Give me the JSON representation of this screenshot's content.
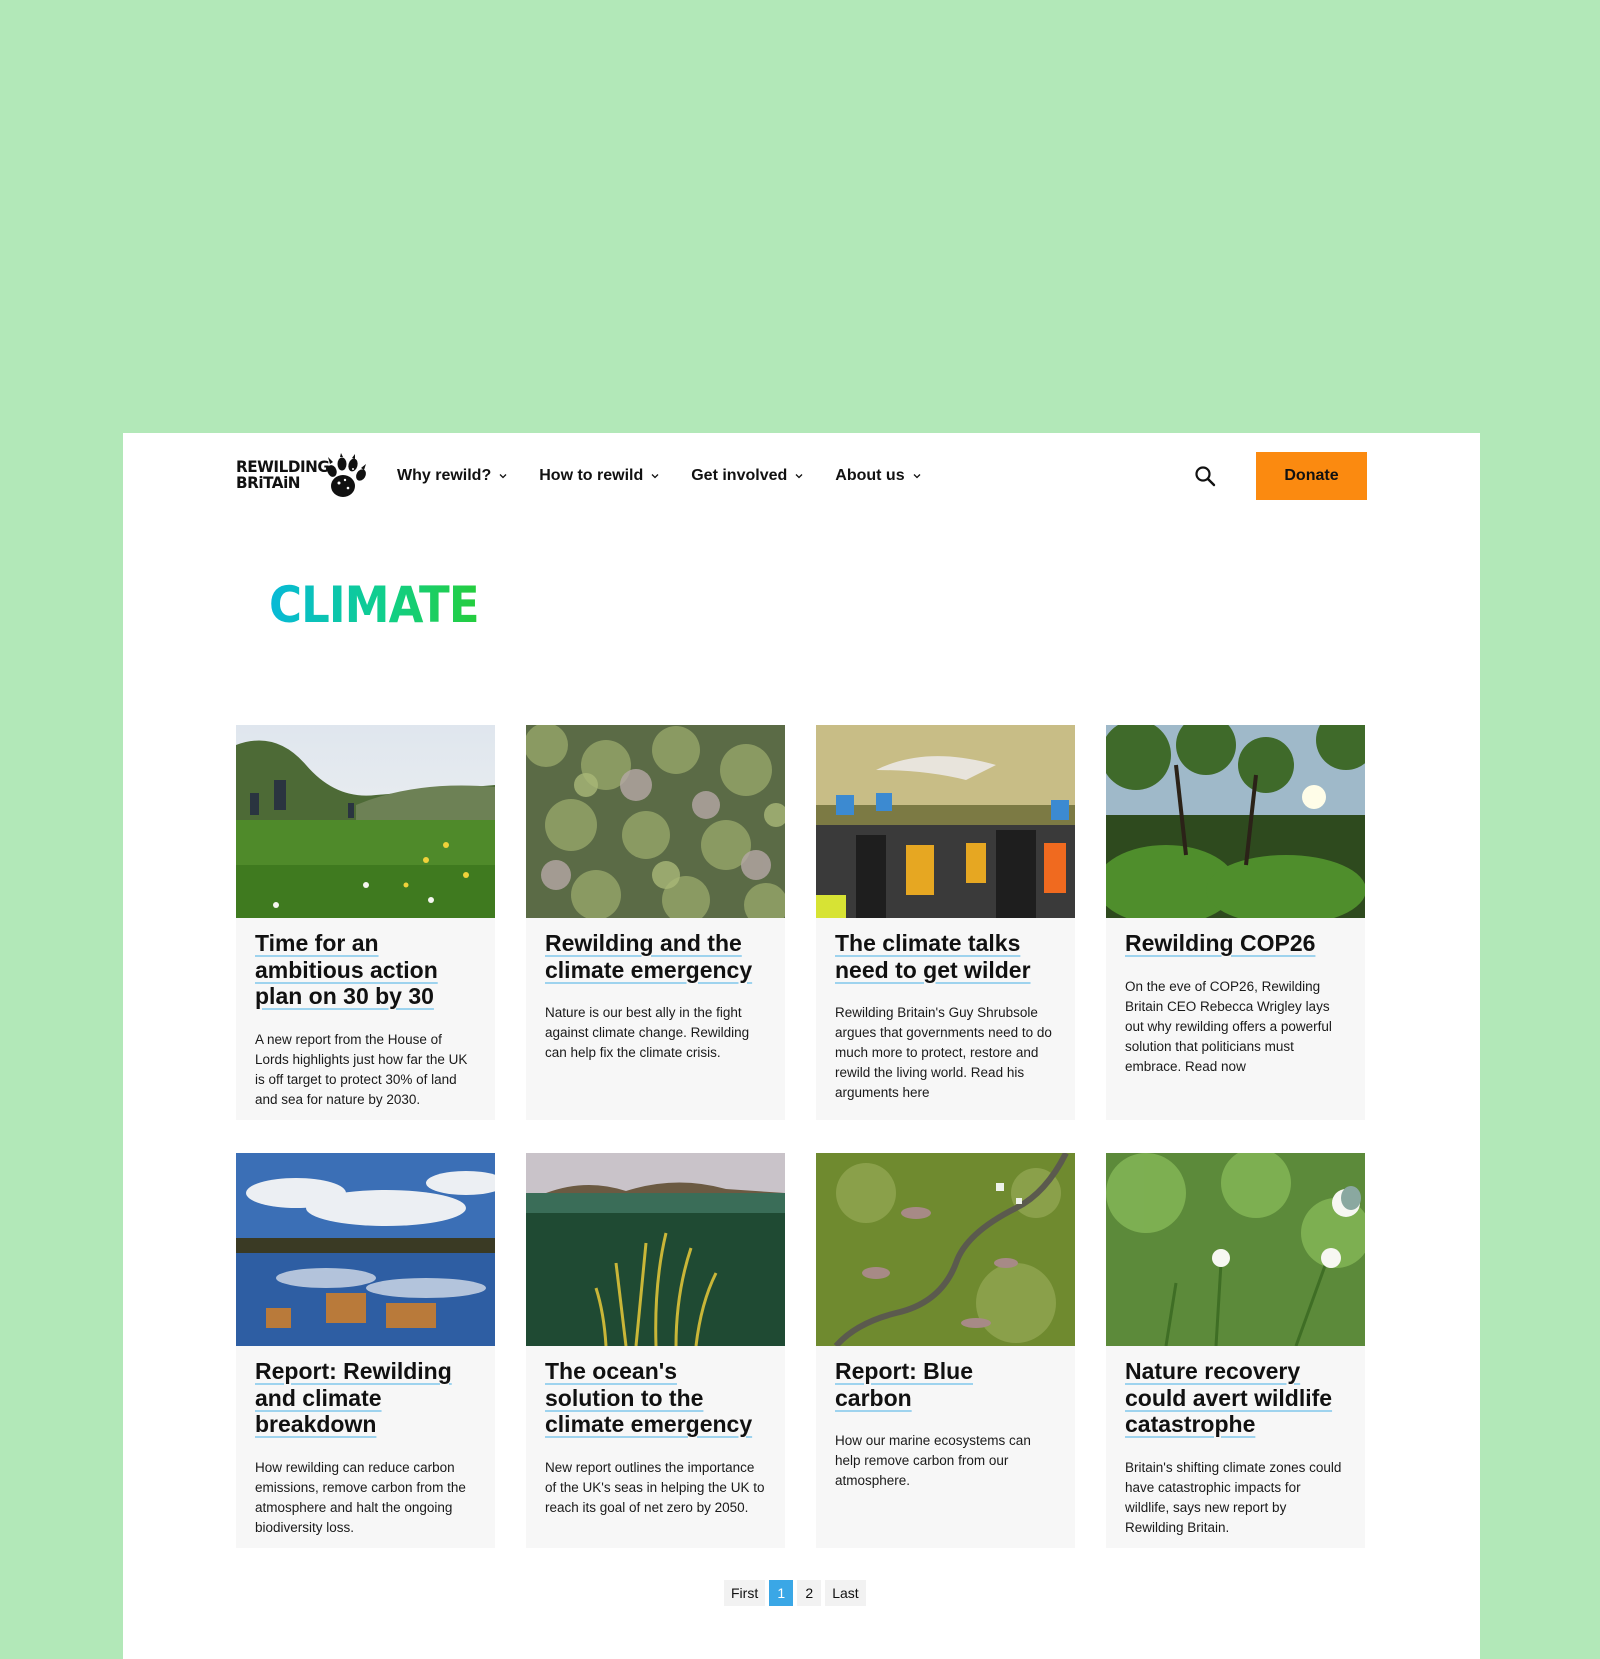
{
  "logo": {
    "line1": "REWILDING",
    "line2": "BRiTAiN",
    "icon": "paw-print-icon"
  },
  "nav": {
    "items": [
      {
        "label": "Why rewild?"
      },
      {
        "label": "How to rewild"
      },
      {
        "label": "Get involved"
      },
      {
        "label": "About us"
      }
    ],
    "search_icon": "search-icon",
    "donate_label": "Donate"
  },
  "colors": {
    "background": "#b2e8b8",
    "donate": "#fb8a10",
    "title_gradient": [
      "#07b9d8",
      "#25cd3c"
    ],
    "link_underline": "#9ed3ee",
    "active_page": "#3aa7e6"
  },
  "page": {
    "title": "CLIMATE"
  },
  "cards": [
    {
      "title": "Time for an ambitious action plan on 30 by 30",
      "desc": "A new report from the House of Lords highlights just how far the UK is off target to protect 30% of land and sea for nature by 2030.",
      "image": "meadow-hikers"
    },
    {
      "title": "Rewilding and the climate emergency",
      "desc": "Nature is our best ally in the fight against climate change. Rewilding can help fix the climate crisis.",
      "image": "forest-canopy-aerial"
    },
    {
      "title": "The climate talks need to get wilder",
      "desc": "Rewilding Britain's Guy Shrubsole argues that governments need to do much more to protect, restore and rewild the living world. Read his arguments here",
      "image": "climate-march-crowd"
    },
    {
      "title": "Rewilding COP26",
      "desc": "On the eve of COP26, Rewilding Britain CEO Rebecca Wrigley lays out why rewilding offers a powerful solution that politicians must embrace. Read now",
      "image": "woodland-sunlight"
    },
    {
      "title": "Report: Rewilding and climate breakdown",
      "desc": "How rewilding can reduce carbon emissions, remove carbon from the atmosphere and halt the ongoing biodiversity loss.",
      "image": "lake-reflection"
    },
    {
      "title": "The ocean's solution to the climate emergency",
      "desc": "New report outlines the importance of the UK's seas in helping the UK to reach its goal of net zero by 2050.",
      "image": "seagrass-underwater"
    },
    {
      "title": "Report: Blue carbon",
      "desc": "How our marine ecosystems can help remove carbon from our atmosphere.",
      "image": "saltmarsh-aerial"
    },
    {
      "title": "Nature recovery could avert wildlife catastrophe",
      "desc": "Britain's shifting climate zones could have catastrophic impacts for wildlife, says new report by Rewilding Britain.",
      "image": "wildflowers-butterfly"
    }
  ],
  "pagination": {
    "first": "First",
    "pages": [
      "1",
      "2"
    ],
    "current": "1",
    "last": "Last"
  }
}
